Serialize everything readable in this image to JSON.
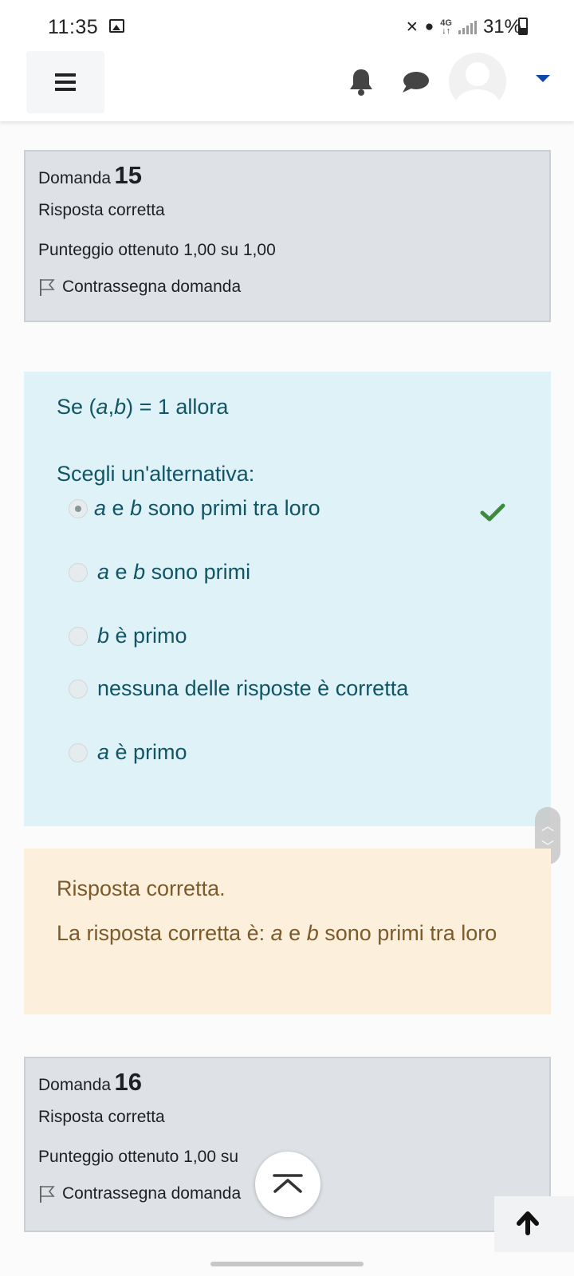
{
  "status_bar": {
    "time": "11:35",
    "network": "4G",
    "battery": "31%"
  },
  "nav": {
    "menu_icon": "hamburger-icon",
    "notifications_icon": "bell-icon",
    "messages_icon": "chat-icon",
    "user_menu_icon": "caret-down-icon"
  },
  "question15": {
    "label": "Domanda",
    "number": "15",
    "state": "Risposta corretta",
    "grade": "Punteggio ottenuto 1,00 su 1,00",
    "flag_label": "Contrassegna domanda"
  },
  "question_content": {
    "text_prefix": "Se (",
    "var_a": "a",
    "comma": ",",
    "var_b": "b",
    "text_suffix": ") = 1 allora",
    "prompt": "Scegli un'alternativa:",
    "options": [
      {
        "a": "a",
        "mid": " e ",
        "b": "b",
        "rest": " sono primi tra loro",
        "selected": true,
        "correct": true
      },
      {
        "a": "a",
        "mid": " e ",
        "b": "b",
        "rest": " sono primi",
        "selected": false
      },
      {
        "b": "b",
        "rest": " è primo",
        "selected": false
      },
      {
        "rest": "nessuna delle risposte è corretta",
        "selected": false
      },
      {
        "a": "a",
        "rest": " è primo",
        "selected": false
      }
    ]
  },
  "feedback": {
    "state": "Risposta corretta.",
    "right_answer_prefix": "La risposta corretta è: ",
    "a": "a",
    "mid": " e ",
    "b": "b",
    "rest": " sono primi tra loro"
  },
  "question16": {
    "label": "Domanda",
    "number": "16",
    "state": "Risposta corretta",
    "grade": "Punteggio ottenuto 1,00 su",
    "flag_label": "Contrassegna domanda"
  },
  "colors": {
    "info_bg": "#dee2e6",
    "question_bg": "#def2f8",
    "question_text": "#115566",
    "feedback_bg": "#fcefdc",
    "feedback_text": "#7d5a29",
    "correct_tick": "#3c8a3c",
    "caret": "#0f47ad"
  }
}
